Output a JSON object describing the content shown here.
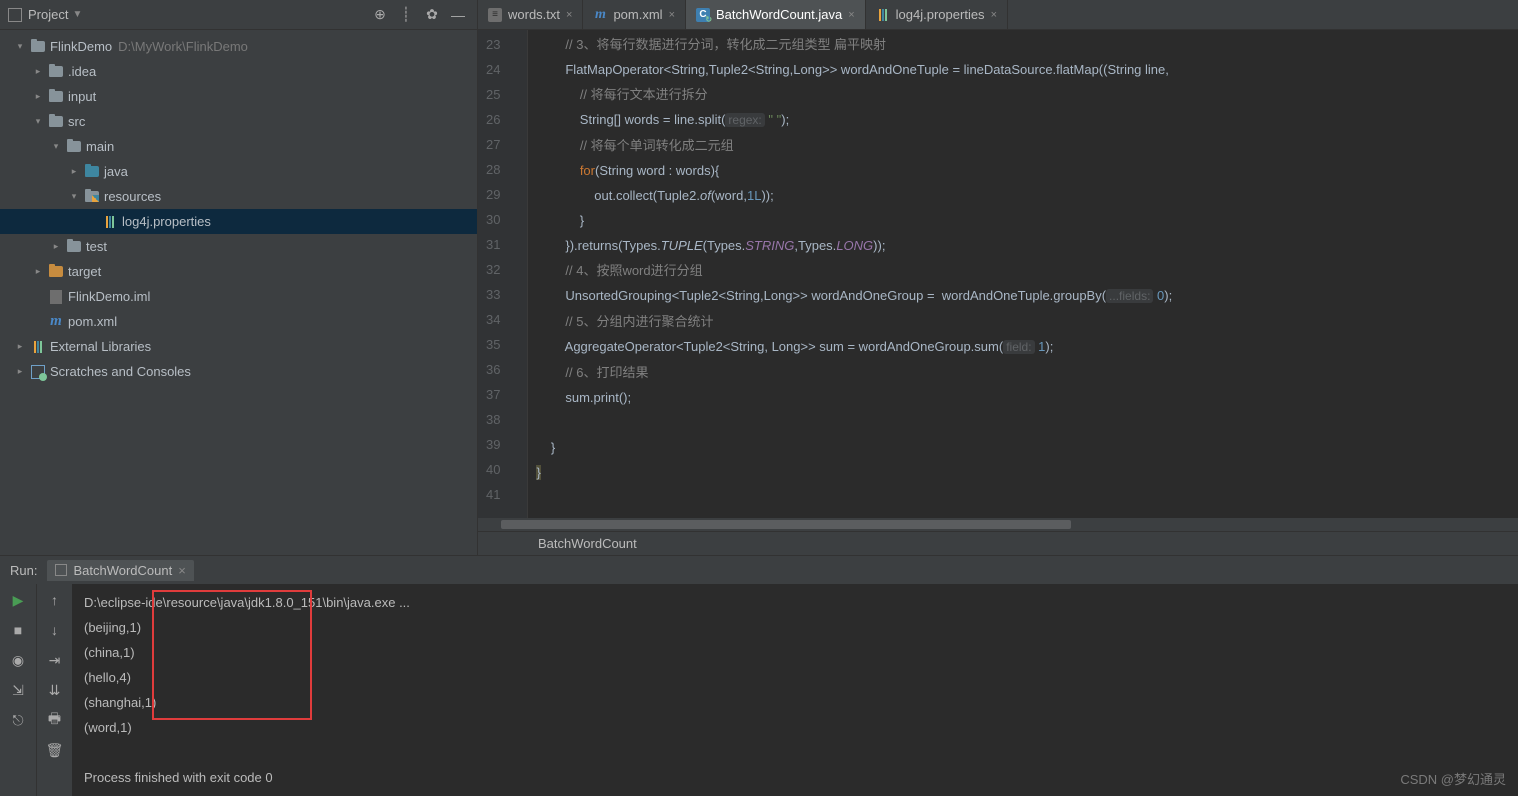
{
  "sidebar": {
    "title": "Project",
    "toolbar_icons": [
      "target",
      "divider",
      "gear",
      "collapse"
    ],
    "tree": [
      {
        "depth": 0,
        "tw": "▾",
        "icon": "folder",
        "label": "FlinkDemo",
        "path": "D:\\MyWork\\FlinkDemo"
      },
      {
        "depth": 1,
        "tw": "▸",
        "icon": "folder",
        "label": ".idea"
      },
      {
        "depth": 1,
        "tw": "▸",
        "icon": "folder",
        "label": "input"
      },
      {
        "depth": 1,
        "tw": "▾",
        "icon": "folder",
        "label": "src"
      },
      {
        "depth": 2,
        "tw": "▾",
        "icon": "folder",
        "label": "main"
      },
      {
        "depth": 3,
        "tw": "▸",
        "icon": "folder-blue",
        "label": "java"
      },
      {
        "depth": 3,
        "tw": "▾",
        "icon": "folder-res",
        "label": "resources"
      },
      {
        "depth": 4,
        "tw": "",
        "icon": "props",
        "label": "log4j.properties",
        "selected": true
      },
      {
        "depth": 2,
        "tw": "▸",
        "icon": "folder",
        "label": "test"
      },
      {
        "depth": 1,
        "tw": "▸",
        "icon": "folder-orange",
        "label": "target"
      },
      {
        "depth": 1,
        "tw": "",
        "icon": "iml",
        "label": "FlinkDemo.iml"
      },
      {
        "depth": 1,
        "tw": "",
        "icon": "m",
        "label": "pom.xml"
      },
      {
        "depth": -1,
        "tw": "▸",
        "icon": "libs",
        "label": "External Libraries"
      },
      {
        "depth": -1,
        "tw": "▸",
        "icon": "scratch",
        "label": "Scratches and Consoles"
      }
    ]
  },
  "tabs": [
    {
      "icon": "txt",
      "label": "words.txt",
      "close": true
    },
    {
      "icon": "m",
      "label": "pom.xml",
      "close": true
    },
    {
      "icon": "j",
      "label": "BatchWordCount.java",
      "close": true,
      "active": true
    },
    {
      "icon": "props",
      "label": "log4j.properties",
      "close": true
    }
  ],
  "editor": {
    "first_line": 23,
    "lines": [
      {
        "n": 23,
        "html": "        <span class='c-com'>// 3、将每行数据进行分词，转化成二元组类型 扁平映射</span>"
      },
      {
        "n": 24,
        "html": "        FlatMapOperator&lt;String,Tuple2&lt;String,Long&gt;&gt; wordAndOneTuple = lineDataSource.flatMap((String line,"
      },
      {
        "n": 25,
        "html": "            <span class='c-com'>// 将每行文本进行拆分</span>"
      },
      {
        "n": 26,
        "html": "            String[] words = line.split(<span class='c-hint'>regex:</span> <span class='c-str'>\" \"</span>);"
      },
      {
        "n": 27,
        "html": "            <span class='c-com'>// 将每个单词转化成二元组</span>"
      },
      {
        "n": 28,
        "html": "            <span class='c-kw'>for</span>(String word : words){"
      },
      {
        "n": 29,
        "html": "                out.collect(Tuple2.<span class='c-stat'>of</span>(word,<span class='c-num'>1L</span>));"
      },
      {
        "n": 30,
        "html": "            }"
      },
      {
        "n": 31,
        "html": "        }).returns(Types.<span class='c-stat'>TUPLE</span>(Types.<span class='c-const'>STRING</span>,Types.<span class='c-const'>LONG</span>));"
      },
      {
        "n": 32,
        "html": "        <span class='c-com'>// 4、按照word进行分组</span>"
      },
      {
        "n": 33,
        "html": "        UnsortedGrouping&lt;Tuple2&lt;String,Long&gt;&gt; wordAndOneGroup =  wordAndOneTuple.groupBy(<span class='c-hint'>...fields:</span> <span class='c-num'>0</span>);"
      },
      {
        "n": 34,
        "html": "        <span class='c-com'>// 5、分组内进行聚合统计</span>"
      },
      {
        "n": 35,
        "html": "        AggregateOperator&lt;Tuple2&lt;String, Long&gt;&gt; sum = wordAndOneGroup.sum(<span class='c-hint'>field:</span> <span class='c-num'>1</span>);"
      },
      {
        "n": 36,
        "html": "        <span class='c-com'>// 6、打印结果</span>"
      },
      {
        "n": 37,
        "html": "        sum.print();"
      },
      {
        "n": 38,
        "html": ""
      },
      {
        "n": 39,
        "html": "    }"
      },
      {
        "n": 40,
        "html": "<span class='c-err'>}</span>"
      },
      {
        "n": 41,
        "html": ""
      }
    ],
    "breadcrumb": "BatchWordCount"
  },
  "run": {
    "label": "Run:",
    "tab": "BatchWordCount",
    "cmd": "D:\\eclipse-ide\\resource\\java\\jdk1.8.0_151\\bin\\java.exe ...",
    "output": [
      "(beijing,1)",
      "(china,1)",
      "(hello,4)",
      "(shanghai,1)",
      "(word,1)",
      "",
      "Process finished with exit code 0"
    ]
  },
  "watermark": "CSDN @梦幻通灵"
}
